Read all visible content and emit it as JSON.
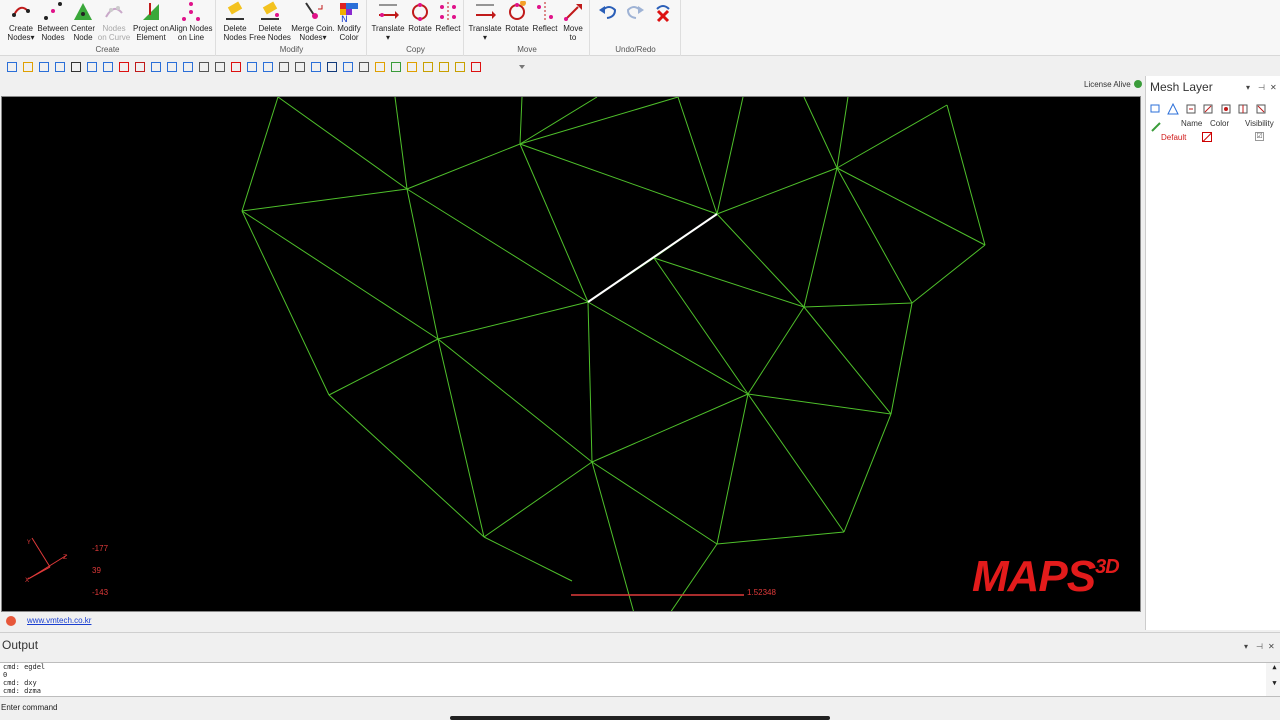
{
  "ribbon": {
    "groups": {
      "create": {
        "label": "Create",
        "buttons": [
          {
            "label": "Create\nNodes▾",
            "icon": "create-nodes-icon"
          },
          {
            "label": "Between\nNodes",
            "icon": "between-nodes-icon"
          },
          {
            "label": "Center\nNode",
            "icon": "center-node-icon"
          },
          {
            "label": "Nodes\non Curve",
            "icon": "nodes-on-curve-icon",
            "disabled": true
          },
          {
            "label": "Project on\nElement",
            "icon": "project-on-element-icon"
          },
          {
            "label": "Align Nodes\non Line",
            "icon": "align-nodes-icon"
          }
        ]
      },
      "modify": {
        "label": "Modify",
        "buttons": [
          {
            "label": "Delete\nNodes",
            "icon": "delete-nodes-icon"
          },
          {
            "label": "Delete\nFree Nodes",
            "icon": "delete-free-nodes-icon"
          },
          {
            "label": "Merge Coin.\nNodes▾",
            "icon": "merge-coincident-nodes-icon"
          },
          {
            "label": "Modify\nColor",
            "icon": "modify-color-icon"
          }
        ]
      },
      "copy": {
        "label": "Copy",
        "buttons": [
          {
            "label": "Translate\n▾",
            "icon": "translate-copy-icon"
          },
          {
            "label": "Rotate",
            "icon": "rotate-copy-icon"
          },
          {
            "label": "Reflect",
            "icon": "reflect-copy-icon"
          }
        ]
      },
      "move": {
        "label": "Move",
        "buttons": [
          {
            "label": "Translate\n▾",
            "icon": "translate-move-icon"
          },
          {
            "label": "Rotate",
            "icon": "rotate-move-icon"
          },
          {
            "label": "Reflect",
            "icon": "reflect-move-icon"
          },
          {
            "label": "Move\nto",
            "icon": "move-to-icon"
          }
        ]
      },
      "undo_redo": {
        "label": "Undo/Redo",
        "buttons": [
          {
            "label": "",
            "icon": "undo-icon"
          },
          {
            "label": "",
            "icon": "redo-icon"
          },
          {
            "label": "",
            "icon": "clear-history-icon"
          }
        ]
      }
    }
  },
  "quick_toolbar": {
    "icons": [
      "new-file-icon",
      "open-file-icon",
      "save-icon",
      "save-as-icon",
      "settings-icon",
      "undo-icon",
      "redo-icon",
      "delete-icon",
      "view-front-icon",
      "view-top-icon",
      "view-iso-icon",
      "view-side-icon",
      "fit-icon",
      "zoom-window-icon",
      "node-icon",
      "rotate-view-icon",
      "measure-icon",
      "render-icon",
      "select-icon",
      "mesh-blue-icon",
      "mesh-dark-icon",
      "view-cube-icon",
      "pan-icon",
      "shade-icon",
      "color-icon",
      "grid-icon",
      "axis-icon",
      "box-icon",
      "line-icon",
      "pick-icon",
      "dropdown-icon"
    ]
  },
  "license": {
    "text": "License Alive"
  },
  "viewport": {
    "coords": {
      "x": "-177",
      "y": "39",
      "z": "-143"
    },
    "scale_value": "1.52348",
    "logo_main": "MAPS",
    "logo_sup": "3D",
    "colors": {
      "mesh": "#4fc02b",
      "selected_edge": "#ffffff",
      "annotation": "#e03a3a"
    }
  },
  "link": {
    "text": "www.vmtech.co.kr"
  },
  "mesh_layer": {
    "title": "Mesh Layer",
    "columns": {
      "name": "Name",
      "color": "Color",
      "visibility": "Visibility"
    },
    "rows": [
      {
        "name": "Default",
        "visible": "☑"
      }
    ]
  },
  "output": {
    "title": "Output",
    "lines": [
      "cmd: egdel",
      "0",
      "cmd: dxy",
      "cmd: dzma"
    ]
  },
  "status": {
    "text": "Enter command"
  }
}
